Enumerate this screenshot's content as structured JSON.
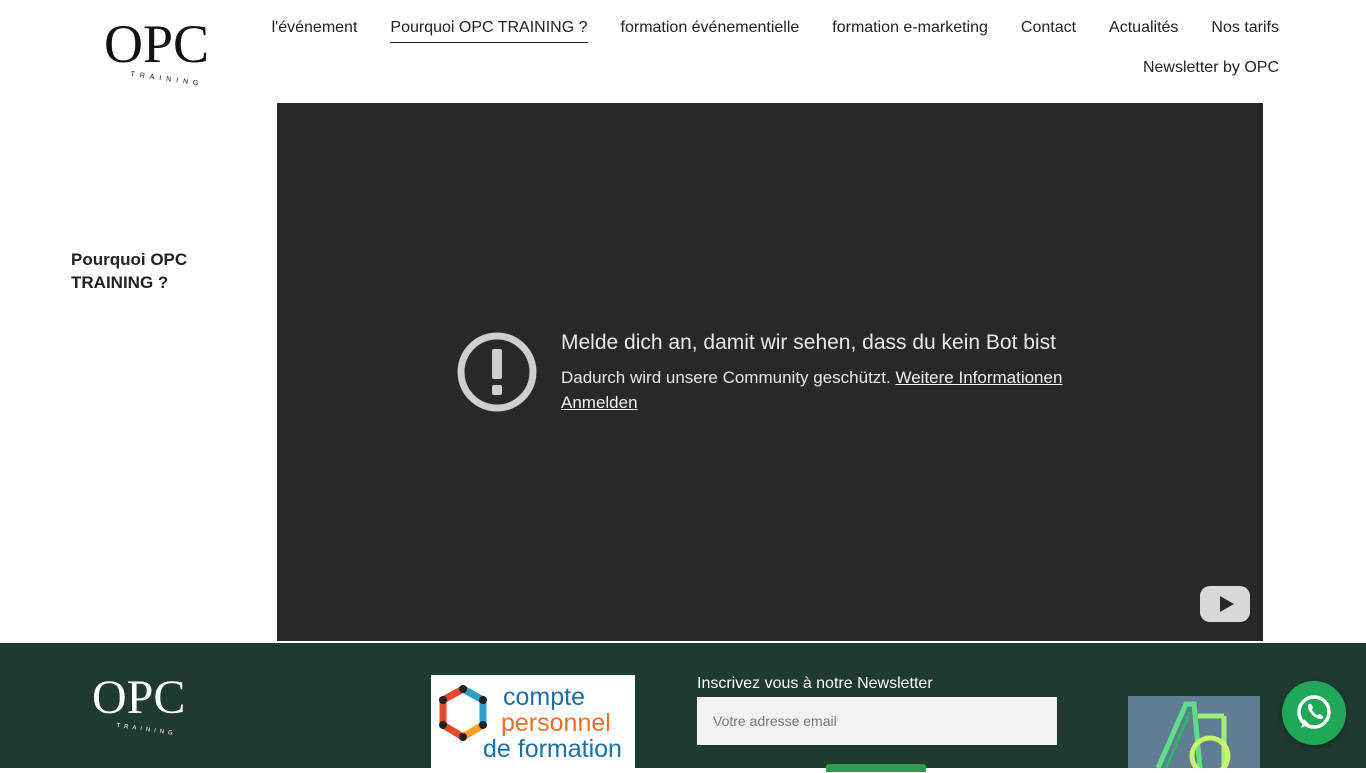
{
  "header": {
    "logo_text": "OPC",
    "logo_sub": "TRAINING",
    "nav_row1": [
      {
        "label": "l'événement"
      },
      {
        "label": "Pourquoi OPC TRAINING ?",
        "active": true
      },
      {
        "label": "formation événementielle"
      },
      {
        "label": "formation e-marketing"
      },
      {
        "label": "Contact"
      },
      {
        "label": "Actualités"
      },
      {
        "label": "Nos tarifs"
      }
    ],
    "nav_row2": [
      {
        "label": "Newsletter by OPC"
      }
    ]
  },
  "sidebar": {
    "title": "Pourquoi OPC TRAINING ?"
  },
  "video": {
    "message_title": "Melde dich an, damit wir sehen, dass du kein Bot bist",
    "message_body": "Dadurch wird unsere Community geschützt.",
    "more_info_link": "Weitere Informationen",
    "sign_in_link": "Anmelden"
  },
  "footer": {
    "logo_text": "OPC",
    "logo_sub": "TRAINING",
    "cpf_lines": [
      "compte",
      "personnel",
      "de formation"
    ],
    "newsletter_label": "Inscrivez vous à notre Newsletter",
    "newsletter_placeholder": "Votre adresse email",
    "accent_color": "#1f3a33",
    "whatsapp_color": "#1fa855"
  }
}
